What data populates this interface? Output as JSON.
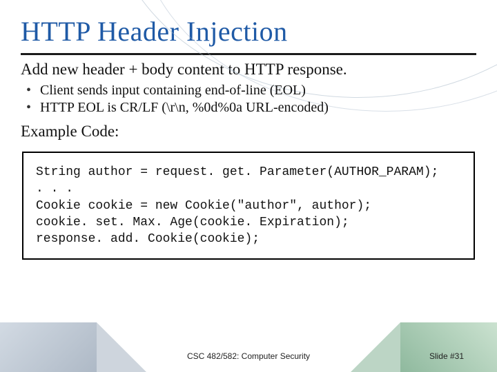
{
  "title": "HTTP Header Injection",
  "lead": "Add new header + body content to HTTP response.",
  "bullets": [
    "Client sends input containing end-of-line (EOL)",
    "HTTP EOL is CR/LF (\\r\\n, %0d%0a URL-encoded)"
  ],
  "subhead": "Example Code:",
  "code": "String author = request. get. Parameter(AUTHOR_PARAM);\n. . .\nCookie cookie = new Cookie(\"author\", author);\ncookie. set. Max. Age(cookie. Expiration);\nresponse. add. Cookie(cookie);",
  "footer_left": "CSC 482/582: Computer Security",
  "footer_right": "Slide #31"
}
